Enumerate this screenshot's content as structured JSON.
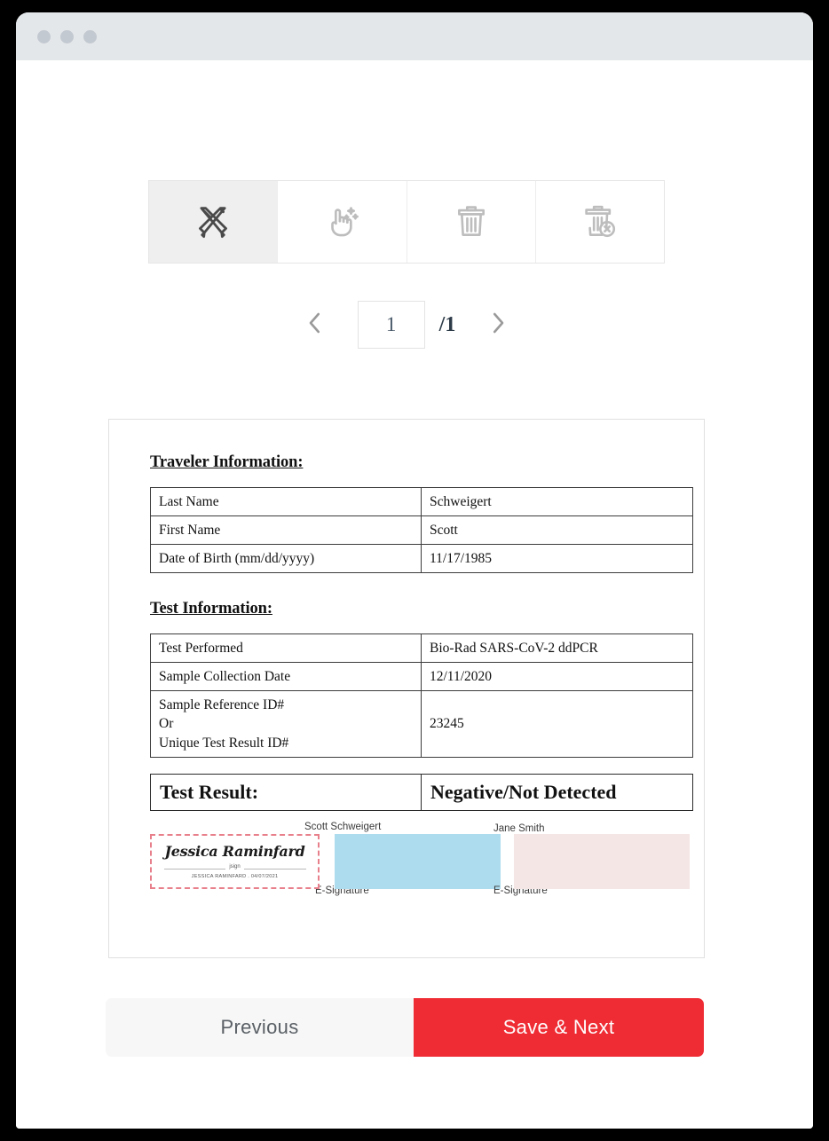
{
  "window": {
    "dots": [
      "dot-1",
      "dot-2",
      "dot-3"
    ]
  },
  "toolbar": {
    "tools": [
      {
        "name": "design-tools-icon",
        "label": "Design Tools",
        "active": true
      },
      {
        "name": "magic-select-icon",
        "label": "Magic Select",
        "active": false
      },
      {
        "name": "trash-icon",
        "label": "Delete",
        "active": false
      },
      {
        "name": "delete-all-icon",
        "label": "Delete All",
        "active": false
      }
    ]
  },
  "pager": {
    "prev_icon": "chevron-left-icon",
    "next_icon": "chevron-right-icon",
    "current_page": "1",
    "total_pages": "/1"
  },
  "document": {
    "traveler_section": {
      "title": "Traveler Information:",
      "rows": [
        {
          "label": "Last Name",
          "value": "Schweigert"
        },
        {
          "label": "First Name",
          "value": "Scott"
        },
        {
          "label": "Date of Birth (mm/dd/yyyy)",
          "value": "11/17/1985"
        }
      ]
    },
    "test_section": {
      "title": "Test Information:",
      "rows": [
        {
          "label": "Test Performed",
          "value": "Bio-Rad SARS-CoV-2 ddPCR"
        },
        {
          "label": "Sample Collection Date",
          "value": "12/11/2020"
        },
        {
          "label": "Sample Reference ID#\nOr\nUnique Test Result ID#",
          "value": "23245"
        }
      ]
    },
    "result_section": {
      "label": "Test Result:",
      "value": "Negative/Not Detected"
    },
    "signatures": [
      {
        "name": "Scott Schweigert",
        "sublabel": "E-Signature",
        "signature_text": "Jessica Raminfard",
        "signature_mark": "jsign",
        "signature_meta": "JESSICA RAMINFARD . 04/07/2021",
        "border_color": "#e8808c"
      },
      {
        "name": "Jane Smith",
        "sublabel": "E-Signature",
        "box_color": "#aedcef"
      }
    ],
    "extra_box_color": "#f4e6e4"
  },
  "footer": {
    "previous_label": "Previous",
    "save_next_label": "Save & Next",
    "accent_color": "#ef2b33"
  }
}
